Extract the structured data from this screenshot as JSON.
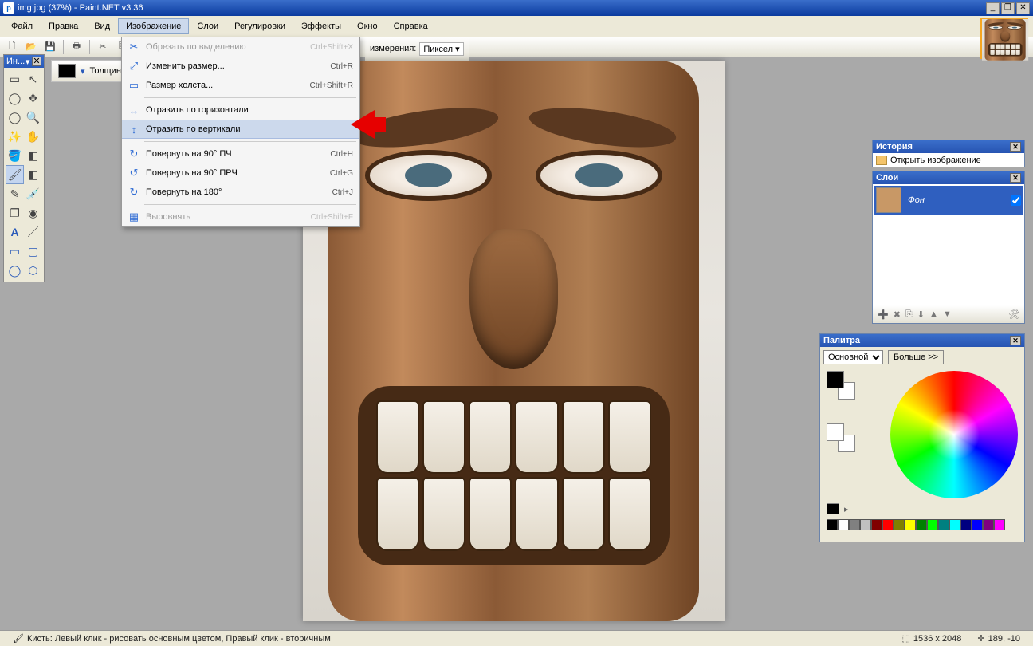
{
  "title": "img.jpg (37%) - Paint.NET v3.36",
  "menubar": [
    "Файл",
    "Правка",
    "Вид",
    "Изображение",
    "Слои",
    "Регулировки",
    "Эффекты",
    "Окно",
    "Справка"
  ],
  "active_menu_index": 3,
  "secondary_toolbar": {
    "label": "измерения:",
    "unit": "Пиксел"
  },
  "option_bar": {
    "label": "Толщина"
  },
  "toolbox_title": "Ин...",
  "menu_items": [
    {
      "icon": "✂",
      "label": "Обрезать по выделению",
      "shortcut": "Ctrl+Shift+X",
      "disabled": true
    },
    {
      "icon": "⤢",
      "label": "Изменить размер...",
      "shortcut": "Ctrl+R"
    },
    {
      "icon": "▭",
      "label": "Размер холста...",
      "shortcut": "Ctrl+Shift+R"
    },
    {
      "sep": true
    },
    {
      "icon": "↔",
      "label": "Отразить по горизонтали",
      "shortcut": ""
    },
    {
      "icon": "↕",
      "label": "Отразить по вертикали",
      "shortcut": "",
      "highlight": true
    },
    {
      "sep": true
    },
    {
      "icon": "↻",
      "label": "Повернуть на 90° ПЧ",
      "shortcut": "Ctrl+H"
    },
    {
      "icon": "↺",
      "label": "Повернуть на 90° ПРЧ",
      "shortcut": "Ctrl+G"
    },
    {
      "icon": "↻",
      "label": "Повернуть на 180°",
      "shortcut": "Ctrl+J"
    },
    {
      "sep": true
    },
    {
      "icon": "▦",
      "label": "Выровнять",
      "shortcut": "Ctrl+Shift+F",
      "disabled": true
    }
  ],
  "history": {
    "title": "История",
    "item": "Открыть изображение"
  },
  "layers": {
    "title": "Слои",
    "layer_name": "Фон"
  },
  "palette": {
    "title": "Палитра",
    "mode": "Основной",
    "more": "Больше >>",
    "swatches": [
      "#000",
      "#fff",
      "#808080",
      "#c0c0c0",
      "#800000",
      "#ff0000",
      "#808000",
      "#ffff00",
      "#008000",
      "#00ff00",
      "#008080",
      "#00ffff",
      "#000080",
      "#0000ff",
      "#800080",
      "#ff00ff"
    ]
  },
  "status": {
    "text": "Кисть: Левый клик - рисовать основным цветом, Правый клик - вторичным",
    "dims": "1536 x 2048",
    "coords": "189, -10"
  }
}
